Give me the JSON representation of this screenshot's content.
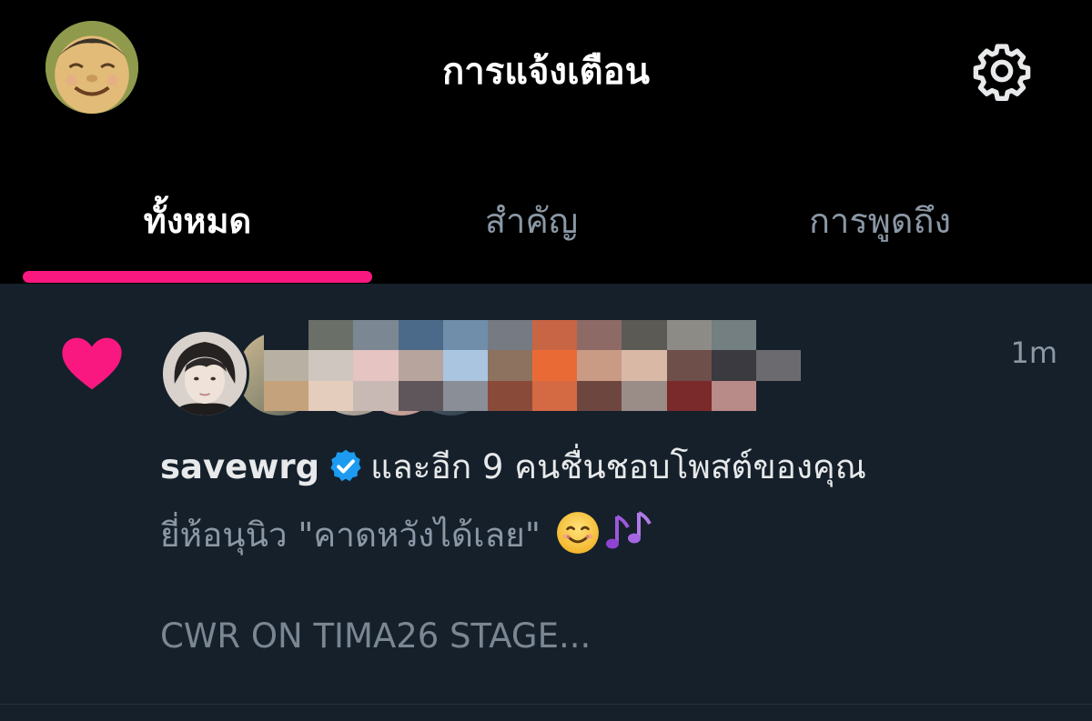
{
  "header": {
    "title": "การแจ้งเตือน",
    "avatar_icon": "cartoon-avatar-icon",
    "settings_icon": "gear-icon"
  },
  "tabs": [
    {
      "label": "ทั้งหมด",
      "active": true
    },
    {
      "label": "สำคัญ",
      "active": false
    },
    {
      "label": "การพูดถึง",
      "active": false
    }
  ],
  "notification": {
    "icon": "heart-icon",
    "timestamp": "1m",
    "username": "savewrg",
    "verified_icon": "verified-badge-icon",
    "action_text": "และอีก 9 คนชื่นชอบโพสต์ของคุณ",
    "post_text": "ยี่ห้อนุนิว \"คาดหวังได้เลย\"",
    "emojis": [
      "smiling-face-emoji",
      "musical-notes-emoji"
    ],
    "post_text_line2": "CWR ON TIMA26 STAGE..."
  },
  "colors": {
    "background": "#15202b",
    "header_background": "#000000",
    "accent": "#f91880",
    "verified": "#1d9bf0",
    "text_primary": "#e7e9ea",
    "text_secondary": "#8b98a5"
  }
}
